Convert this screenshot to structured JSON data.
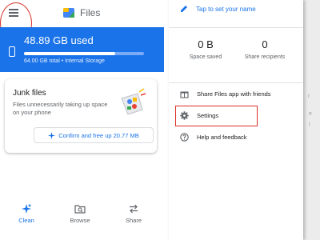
{
  "left": {
    "app_title": "Files",
    "storage": {
      "used": "48.89 GB used",
      "total": "64.00 GB total • Internal Storage",
      "used_fraction": 0.76
    },
    "junk_card": {
      "title": "Junk files",
      "description": "Files unnecessarily taking up space on your phone",
      "button": "Confirm and free up 20.77 MB"
    },
    "bottom_nav": [
      {
        "label": "Clean",
        "icon": "sparkle-icon",
        "active": true
      },
      {
        "label": "Browse",
        "icon": "folder-search-icon",
        "active": false
      },
      {
        "label": "Share",
        "icon": "swap-icon",
        "active": false
      }
    ]
  },
  "drawer": {
    "signin": "Tap to set your name",
    "stats": [
      {
        "value": "0 B",
        "label": "Space saved"
      },
      {
        "value": "0",
        "label": "Share recipients"
      }
    ],
    "menu": [
      {
        "label": "Share Files app with friends",
        "icon": "gift-icon"
      },
      {
        "label": "Settings",
        "icon": "gear-icon"
      },
      {
        "label": "Help and feedback",
        "icon": "help-icon"
      }
    ]
  },
  "background": {
    "fragments": [
      "r",
      "e",
      "l"
    ]
  },
  "colors": {
    "primary": "#1a73e8",
    "annotation": "#d93025"
  }
}
